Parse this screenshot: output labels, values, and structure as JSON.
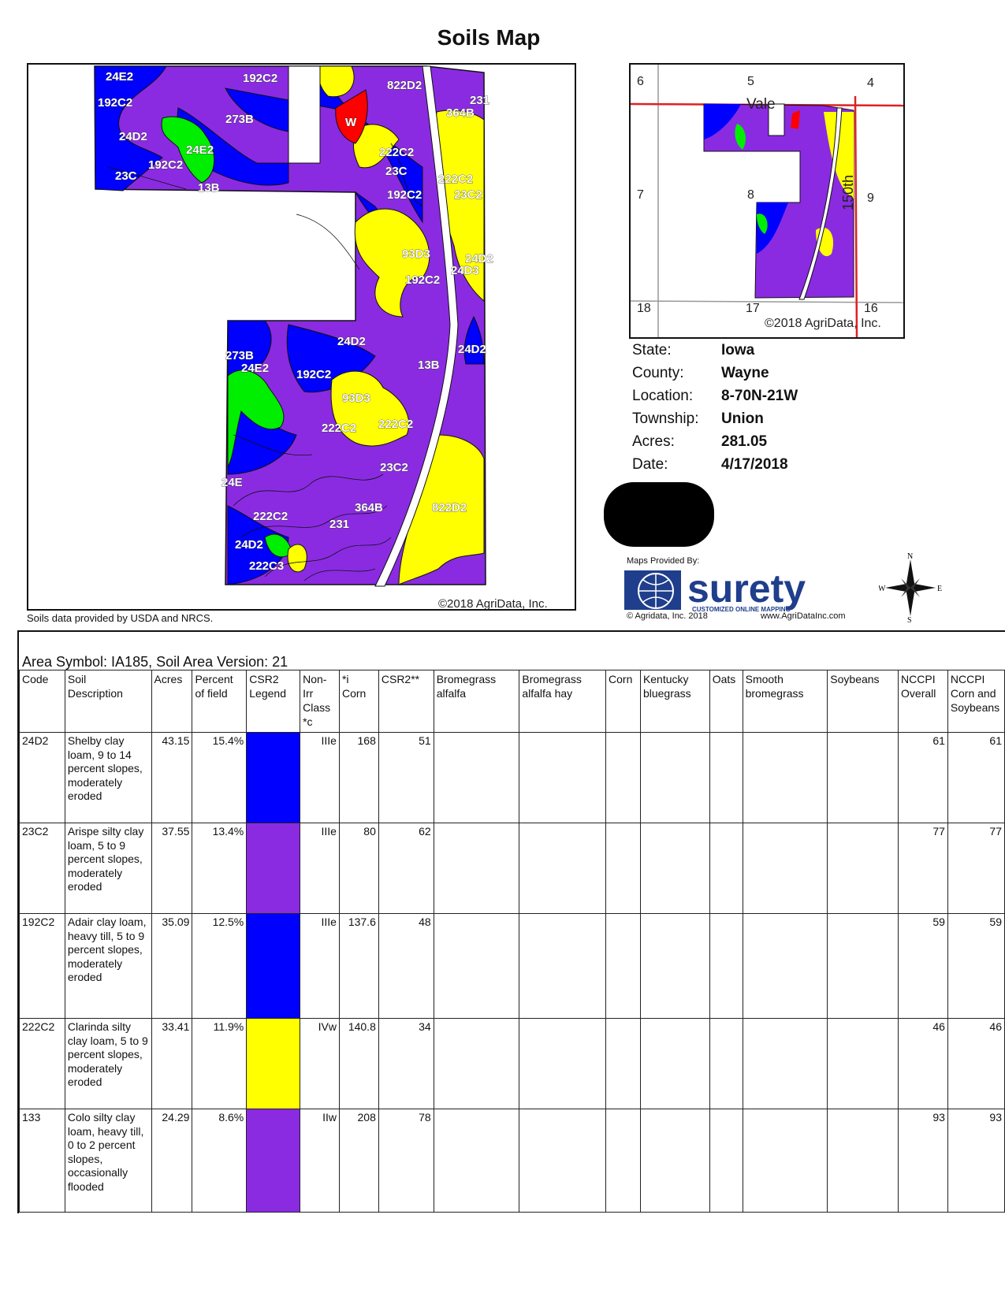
{
  "title": "Soils Map",
  "main_map": {
    "labels": [
      "24E2",
      "192C2",
      "192C2",
      "273B",
      "24D2",
      "24E2",
      "192C2",
      "23C",
      "13B",
      "W",
      "822D2",
      "231",
      "364B",
      "222C2",
      "23C",
      "222C2",
      "192C2",
      "23C2",
      "93D3",
      "24D2",
      "24D3",
      "192C2",
      "24D2",
      "273B",
      "24E2",
      "192C2",
      "13B",
      "24D2",
      "93D3",
      "222C2",
      "222C2",
      "23C2",
      "24E",
      "222C2",
      "364B",
      "231",
      "822D2",
      "24D2",
      "222C3"
    ],
    "copyright": "©2018 AgriData, Inc.",
    "source": "Soils data provided by USDA and NRCS."
  },
  "inset_map": {
    "sections": [
      "6",
      "5",
      "4",
      "7",
      "8",
      "9",
      "18",
      "17",
      "16"
    ],
    "road_vale": "Vale",
    "road_150th": "150th",
    "copyright": "©2018 AgriData, Inc."
  },
  "info": [
    {
      "label": "State:",
      "value": "Iowa"
    },
    {
      "label": "County:",
      "value": "Wayne"
    },
    {
      "label": "Location:",
      "value": "8-70N-21W"
    },
    {
      "label": "Township:",
      "value": "Union"
    },
    {
      "label": "Acres:",
      "value": "281.05"
    },
    {
      "label": "Date:",
      "value": "4/17/2018"
    }
  ],
  "branding": {
    "provided_by": "Maps Provided By:",
    "logo_text": "surety",
    "tagline": "CUSTOMIZED ONLINE MAPPING",
    "copyright": "© Agridata, Inc. 2018",
    "website": "www.AgriDataInc.com"
  },
  "compass": {
    "n": "N",
    "s": "S",
    "e": "E",
    "w": "W"
  },
  "table": {
    "area_symbol": "Area Symbol: IA185, Soil Area Version: 21",
    "headers": [
      "Code",
      "Soil Description",
      "Acres",
      "Percent of field",
      "CSR2 Legend",
      "Non-Irr Class *c",
      "*i Corn",
      "CSR2**",
      "Bromegrass alfalfa",
      "Bromegrass alfalfa hay",
      "Corn",
      "Kentucky bluegrass",
      "Oats",
      "Smooth bromegrass",
      "Soybeans",
      "NCCPI Overall",
      "NCCPI Corn and Soybeans"
    ],
    "header_lines": [
      [
        "Code"
      ],
      [
        "Soil",
        "Description"
      ],
      [
        "Acres"
      ],
      [
        "Percent",
        "of field"
      ],
      [
        "CSR2",
        "Legend"
      ],
      [
        "Non-",
        "Irr",
        "Class",
        "*c"
      ],
      [
        "*i",
        "Corn"
      ],
      [
        "CSR2**"
      ],
      [
        "Bromegrass",
        "alfalfa"
      ],
      [
        "Bromegrass",
        "alfalfa hay"
      ],
      [
        "Corn"
      ],
      [
        "Kentucky",
        "bluegrass"
      ],
      [
        "Oats"
      ],
      [
        "Smooth",
        "bromegrass"
      ],
      [
        "Soybeans"
      ],
      [
        "NCCPI",
        "Overall"
      ],
      [
        "NCCPI",
        "Corn and",
        "Soybeans"
      ]
    ],
    "rows": [
      {
        "code": "24D2",
        "description": "Shelby clay loam, 9 to 14 percent slopes, moderately eroded",
        "acres": "43.15",
        "percent": "15.4%",
        "legend_color": "#0000ff",
        "class": "IIIe",
        "corn": "168",
        "csr2": "51",
        "nccpi_overall": "61",
        "nccpi_corn_soy": "61"
      },
      {
        "code": "23C2",
        "description": "Arispe silty clay loam, 5 to 9 percent slopes, moderately eroded",
        "acres": "37.55",
        "percent": "13.4%",
        "legend_color": "#8a2be2",
        "class": "IIIe",
        "corn": "80",
        "csr2": "62",
        "nccpi_overall": "77",
        "nccpi_corn_soy": "77"
      },
      {
        "code": "192C2",
        "description": "Adair clay loam, heavy till, 5 to 9 percent slopes, moderately eroded",
        "acres": "35.09",
        "percent": "12.5%",
        "legend_color": "#0000ff",
        "class": "IIIe",
        "corn": "137.6",
        "csr2": "48",
        "nccpi_overall": "59",
        "nccpi_corn_soy": "59"
      },
      {
        "code": "222C2",
        "description": "Clarinda silty clay loam, 5 to 9 percent slopes, moderately eroded",
        "acres": "33.41",
        "percent": "11.9%",
        "legend_color": "#ffff00",
        "class": "IVw",
        "corn": "140.8",
        "csr2": "34",
        "nccpi_overall": "46",
        "nccpi_corn_soy": "46"
      },
      {
        "code": "133",
        "description": "Colo silty clay loam, heavy till, 0 to 2 percent slopes, occasionally flooded",
        "acres": "24.29",
        "percent": "8.6%",
        "legend_color": "#8a2be2",
        "class": "IIw",
        "corn": "208",
        "csr2": "78",
        "nccpi_overall": "93",
        "nccpi_corn_soy": "93"
      }
    ]
  }
}
